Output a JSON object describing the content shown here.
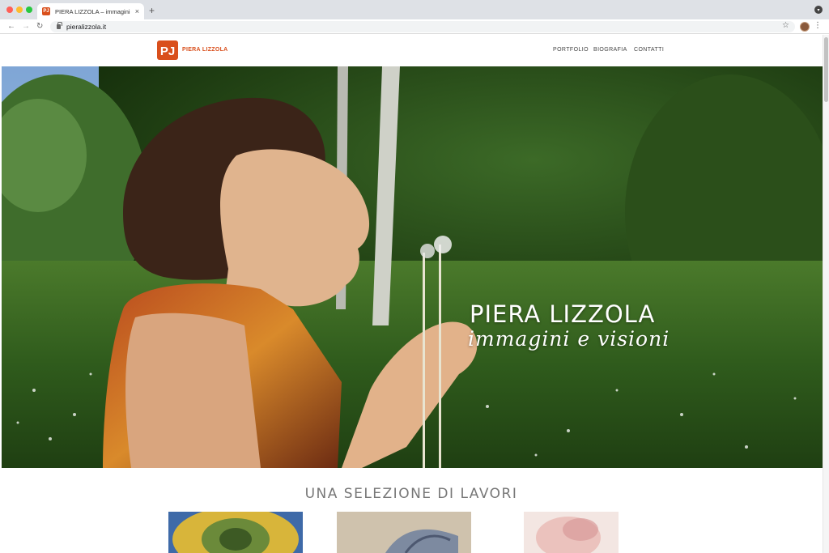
{
  "browser": {
    "tab_title": "PIERA LIZZOLA – immagini e vi",
    "tab_favicon_text": "PJ",
    "close_glyph": "×",
    "new_tab_glyph": "+",
    "back_glyph": "←",
    "forward_glyph": "→",
    "reload_glyph": "↻",
    "url": "pieralizzola.it",
    "star_glyph": "☆",
    "menu_glyph": "⋮",
    "circle_glyph": "▾"
  },
  "site": {
    "logo_mark": "PJ",
    "logo_text": "PIERA LIZZOLA",
    "brand_color": "#d94f1c",
    "nav": [
      {
        "label": "PORTFOLIO"
      },
      {
        "label": "BIOGRAFIA"
      },
      {
        "label": "CONTATTI"
      }
    ]
  },
  "hero": {
    "title": "PIERA LIZZOLA",
    "subtitle": "immagini e visioni"
  },
  "section": {
    "title": "UNA SELEZIONE DI LAVORI"
  }
}
